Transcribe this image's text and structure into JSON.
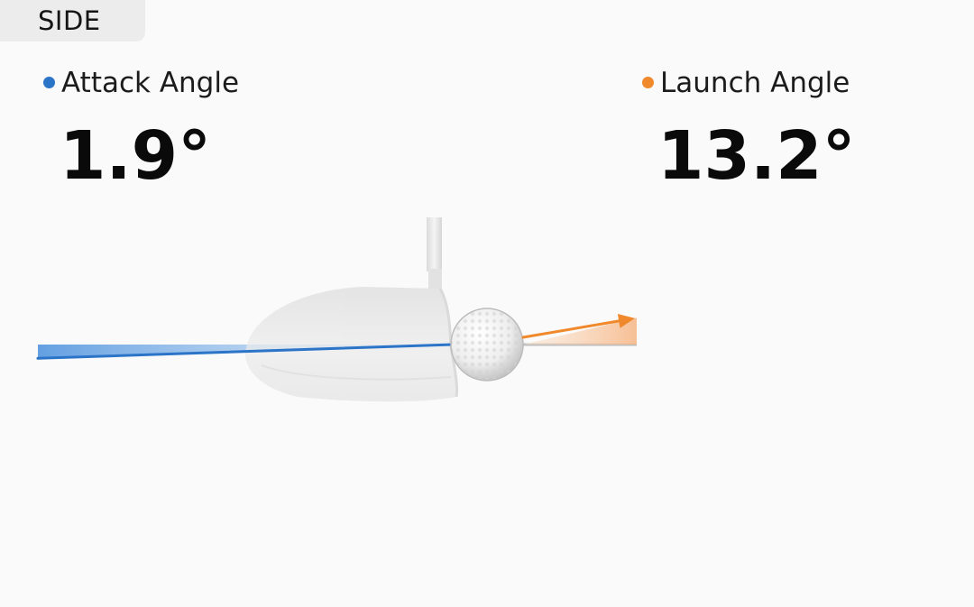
{
  "view": {
    "label": "SIDE"
  },
  "metrics": {
    "attack_angle": {
      "label": "Attack Angle",
      "value": "1.9°",
      "degrees": 1.9,
      "color": "#2b74c8"
    },
    "launch_angle": {
      "label": "Launch Angle",
      "value": "13.2°",
      "degrees": 13.2,
      "color": "#f0892c"
    }
  },
  "icons": {
    "club": "driver-head-icon",
    "ball": "golf-ball-icon"
  }
}
